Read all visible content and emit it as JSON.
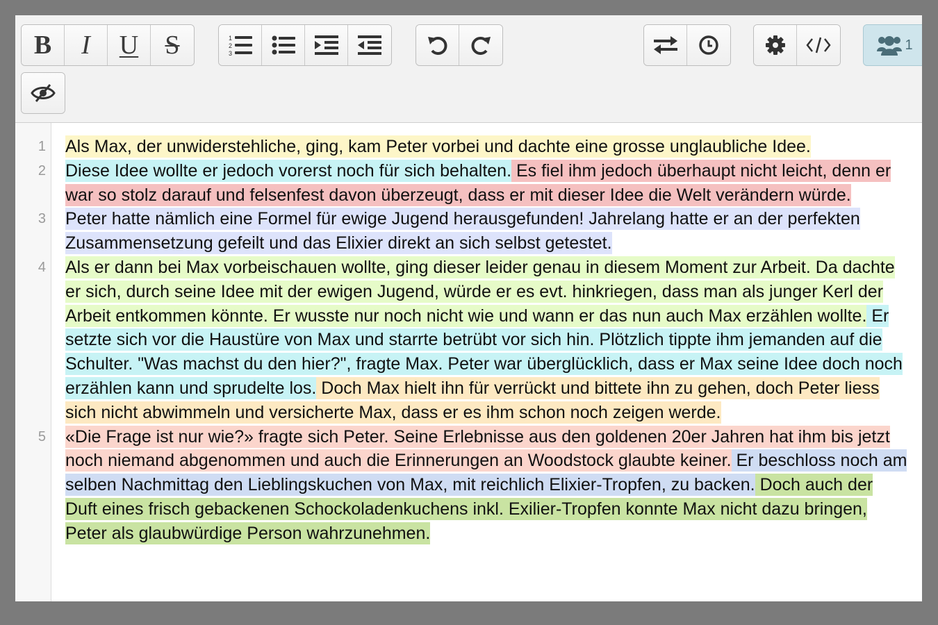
{
  "colors": {
    "yellow": "#fdf6c8",
    "cyan": "#c7f3f5",
    "red": "#f5c0c0",
    "lavender": "#dde3fb",
    "lime": "#e6fbc8",
    "orange": "#fde9c2",
    "salmon": "#fbd5cc",
    "blue": "#cfdcf3",
    "green": "#c9e3a2"
  },
  "toolbar": {
    "groups": [
      {
        "name": "format",
        "buttons": [
          {
            "name": "bold-button",
            "icon": "bold-icon",
            "glyph": "B"
          },
          {
            "name": "italic-button",
            "icon": "italic-icon",
            "glyph": "I"
          },
          {
            "name": "underline-button",
            "icon": "underline-icon",
            "glyph": "U"
          },
          {
            "name": "strikethrough-button",
            "icon": "strikethrough-icon",
            "glyph": "S"
          }
        ]
      },
      {
        "name": "lists",
        "buttons": [
          {
            "name": "ordered-list-button",
            "icon": "ordered-list-icon"
          },
          {
            "name": "unordered-list-button",
            "icon": "unordered-list-icon"
          },
          {
            "name": "indent-button",
            "icon": "indent-icon"
          },
          {
            "name": "outdent-button",
            "icon": "outdent-icon"
          }
        ]
      },
      {
        "name": "history",
        "buttons": [
          {
            "name": "undo-button",
            "icon": "undo-icon"
          },
          {
            "name": "redo-button",
            "icon": "redo-icon"
          }
        ]
      },
      {
        "name": "sync",
        "buttons": [
          {
            "name": "swap-button",
            "icon": "swap-arrows-icon"
          },
          {
            "name": "history-button",
            "icon": "clock-icon"
          }
        ]
      },
      {
        "name": "settings",
        "buttons": [
          {
            "name": "settings-button",
            "icon": "gear-icon"
          },
          {
            "name": "source-code-button",
            "icon": "code-icon"
          }
        ]
      },
      {
        "name": "users",
        "buttons": [
          {
            "name": "users-button",
            "icon": "users-icon",
            "count": "1"
          }
        ]
      },
      {
        "name": "visibility",
        "buttons": [
          {
            "name": "toggle-visibility-button",
            "icon": "eye-slash-icon"
          }
        ]
      }
    ],
    "users_count": "1"
  },
  "document": {
    "line_numbers": [
      "1",
      "2",
      "3",
      "4",
      "5"
    ],
    "paragraphs": [
      [
        {
          "text": "Als Max, der unwiderstehliche, ging, kam Peter vorbei und dachte eine grosse unglaubliche Idee.",
          "color": "yellow"
        }
      ],
      [
        {
          "text": "Diese Idee wollte er jedoch vorerst noch für sich behalten.",
          "color": "cyan"
        },
        {
          "text": " Es fiel ihm jedoch überhaupt nicht leicht, denn er war so stolz darauf und felsenfest davon überzeugt, dass er mit dieser Idee die Welt verändern würde.",
          "color": "red"
        }
      ],
      [
        {
          "text": "Peter hatte nämlich eine Formel für ewige Jugend herausgefunden! Jahrelang hatte er an der perfekten Zusammensetzung gefeilt und das Elixier direkt an sich selbst getestet.",
          "color": "lavender"
        }
      ],
      [
        {
          "text": "Als er dann bei Max vorbeischauen wollte, ging dieser leider genau in diesem Moment zur Arbeit. Da dachte er sich, durch seine Idee mit der ewigen Jugend, würde er es evt. hinkriegen, dass man als junger Kerl der Arbeit entkommen könnte. Er wusste nur noch nicht wie und wann er das nun auch Max erzählen wollte.",
          "color": "lime"
        },
        {
          "text": " Er setzte sich vor die Haustüre von Max und starrte betrübt vor sich hin. Plötzlich tippte ihm jemanden auf die Schulter. \"Was machst du den hier?\", fragte Max. Peter war überglücklich, dass er Max seine Idee doch noch erzählen kann und sprudelte los.",
          "color": "cyan"
        },
        {
          "text": " Doch Max hielt ihn für verrückt und bittete ihn zu gehen, doch Peter liess sich nicht abwimmeln und versicherte Max, dass er es ihm schon noch zeigen werde.",
          "color": "orange"
        }
      ],
      [
        {
          "text": "«Die Frage ist nur wie?» fragte sich Peter. Seine Erlebnisse aus den goldenen 20er Jahren hat ihm bis jetzt noch niemand abgenommen und auch die Erinnerungen an Woodstock glaubte keiner.",
          "color": "salmon"
        },
        {
          "text": " Er beschloss noch am selben Nachmittag den Lieblingskuchen von Max, mit reichlich Elixier-Tropfen, zu backen.",
          "color": "blue"
        },
        {
          "text": " Doch auch der Duft eines frisch gebackenen Schockoladenkuchens inkl. Exilier-Tropfen konnte Max nicht dazu bringen, Peter als glaubwürdige Person wahrzunehmen.",
          "color": "green"
        }
      ]
    ]
  }
}
